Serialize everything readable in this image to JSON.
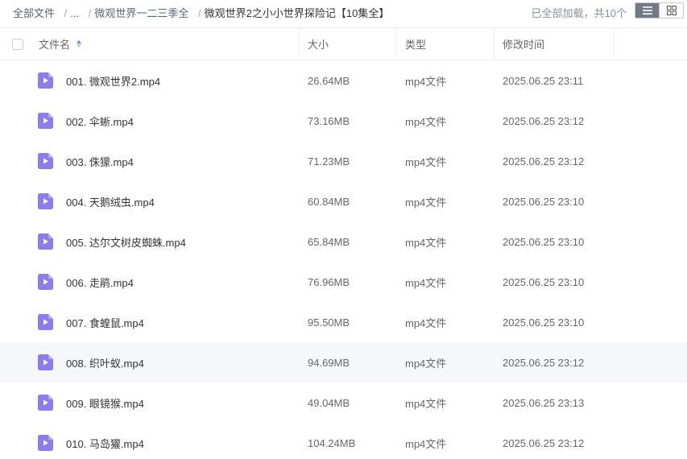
{
  "breadcrumb": {
    "root": "全部文件",
    "ellipsis": "...",
    "parent": "微观世界一二三季全",
    "current": "微观世界2之小小世界探险记【10集全】",
    "separator": "/"
  },
  "status": "已全部加载，共10个",
  "view_toggle": {
    "list_icon": "list-icon",
    "grid_icon": "grid-icon"
  },
  "columns": {
    "name": "文件名",
    "size": "大小",
    "type": "类型",
    "mtime": "修改时间"
  },
  "colors": {
    "file_icon": "#8c7cf0",
    "accent": "#4e8af6",
    "hover_row": "#f6f7fb"
  },
  "files": [
    {
      "name": "001. 微观世界2.mp4",
      "size": "26.64MB",
      "type": "mp4文件",
      "mtime": "2025.06.25 23:11"
    },
    {
      "name": "002. 伞蜥.mp4",
      "size": "73.16MB",
      "type": "mp4文件",
      "mtime": "2025.06.25 23:12"
    },
    {
      "name": "003. 侏獴.mp4",
      "size": "71.23MB",
      "type": "mp4文件",
      "mtime": "2025.06.25 23:12"
    },
    {
      "name": "004. 天鹅绒虫.mp4",
      "size": "60.84MB",
      "type": "mp4文件",
      "mtime": "2025.06.25 23:10"
    },
    {
      "name": "005. 达尔文树皮蜘蛛.mp4",
      "size": "65.84MB",
      "type": "mp4文件",
      "mtime": "2025.06.25 23:10"
    },
    {
      "name": "006. 走鹃.mp4",
      "size": "76.96MB",
      "type": "mp4文件",
      "mtime": "2025.06.25 23:10"
    },
    {
      "name": "007. 食蝗鼠.mp4",
      "size": "95.50MB",
      "type": "mp4文件",
      "mtime": "2025.06.25 23:10"
    },
    {
      "name": "008. 织叶蚁.mp4",
      "size": "94.69MB",
      "type": "mp4文件",
      "mtime": "2025.06.25 23:12"
    },
    {
      "name": "009. 眼镜猴.mp4",
      "size": "49.04MB",
      "type": "mp4文件",
      "mtime": "2025.06.25 23:13"
    },
    {
      "name": "010. 马岛獾.mp4",
      "size": "104.24MB",
      "type": "mp4文件",
      "mtime": "2025.06.25 23:12"
    }
  ]
}
